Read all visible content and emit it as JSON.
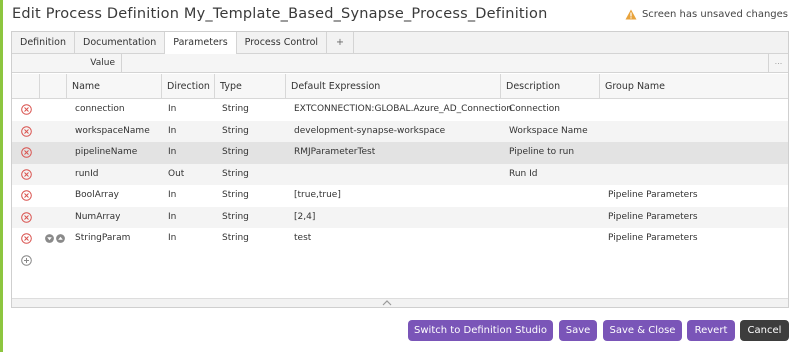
{
  "title": "Edit Process Definition My_Template_Based_Synapse_Process_Definition",
  "unsaved_text": "Screen has unsaved changes",
  "tabs": [
    "Definition",
    "Documentation",
    "Parameters",
    "Process Control",
    "+"
  ],
  "value_label": "Value",
  "value_ellipsis": "...",
  "columns": [
    "Name",
    "Direction",
    "Type",
    "Default Expression",
    "Description",
    "Group Name"
  ],
  "rows": [
    {
      "name": "connection",
      "direction": "In",
      "type": "String",
      "default": "EXTCONNECTION:GLOBAL.Azure_AD_Connection",
      "description": "Connection",
      "group": ""
    },
    {
      "name": "workspaceName",
      "direction": "In",
      "type": "String",
      "default": "development-synapse-workspace",
      "description": "Workspace Name",
      "group": ""
    },
    {
      "name": "pipelineName",
      "direction": "In",
      "type": "String",
      "default": "RMJParameterTest",
      "description": "Pipeline to run",
      "group": ""
    },
    {
      "name": "runId",
      "direction": "Out",
      "type": "String",
      "default": "",
      "description": "Run Id",
      "group": ""
    },
    {
      "name": "BoolArray",
      "direction": "In",
      "type": "String",
      "default": "[true,true]",
      "description": "",
      "group": "Pipeline Parameters"
    },
    {
      "name": "NumArray",
      "direction": "In",
      "type": "String",
      "default": "[2,4]",
      "description": "",
      "group": "Pipeline Parameters"
    },
    {
      "name": "StringParam",
      "direction": "In",
      "type": "String",
      "default": "test",
      "description": "",
      "group": "Pipeline Parameters"
    }
  ],
  "buttons": {
    "switch": "Switch to Definition Studio",
    "save": "Save",
    "save_close": "Save & Close",
    "revert": "Revert",
    "cancel": "Cancel"
  },
  "colors": {
    "accent": "#7a55b8",
    "cancel": "#3d3d3d",
    "delete_icon": "#d9534f",
    "warning": "#e8a33c",
    "left_bar": "#8dc63f"
  },
  "icons": {
    "warning": "warning-icon",
    "delete": "delete-row-icon",
    "move_down": "move-down-icon",
    "move_up": "move-up-icon",
    "add_row": "add-row-icon",
    "collapse": "chevron-up-icon"
  }
}
